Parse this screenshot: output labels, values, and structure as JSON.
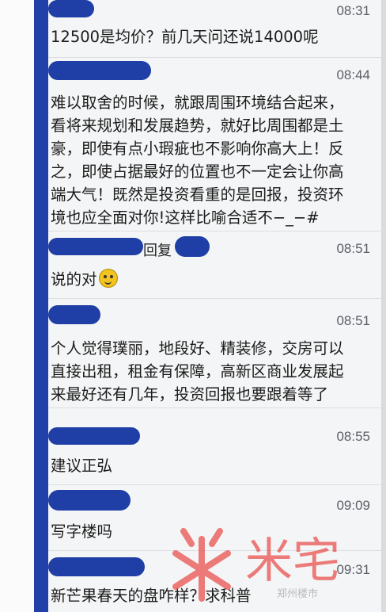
{
  "messages": [
    {
      "time": "08:31",
      "text": "12500是均价？前几天问还说14000呢"
    },
    {
      "time": "08:44",
      "text": "难以取舍的时候，就跟周围环境结合起来，\n看将来规划和发展趋势，就好比周围都是土\n豪，即使有点小瑕疵也不影响你高大上！反\n之，即使占据最好的位置也不一定会让你高\n端大气！既然是投资看重的是回报，投资环\n境也应全面对你!这样比喻合适不−_−#"
    },
    {
      "time": "08:51",
      "reply_label": "回复",
      "text": "说的对"
    },
    {
      "time": "08:51",
      "text": "个人觉得璞丽，地段好、精装修，交房可以\n直接出租，租金有保障，高新区商业发展起\n来最好还有几年，投资回报也要跟着等了"
    },
    {
      "time": "08:55",
      "text": "建议正弘"
    },
    {
      "time": "09:09",
      "text": "写字楼吗"
    },
    {
      "time": "09:31",
      "text": "新芒果春天的盘咋样？求科普"
    }
  ],
  "watermark": {
    "logo_text": "米宅",
    "site_text": "郑州楼市",
    "color": "#e8524f"
  },
  "icons": {
    "emoji": "smiley-emoji-icon"
  }
}
